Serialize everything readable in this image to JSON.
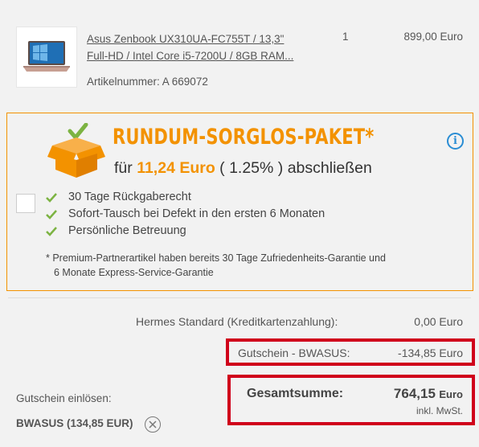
{
  "product": {
    "title_line1": "Asus Zenbook UX310UA-FC755T / 13,3\"",
    "title_line2": "Full-HD / Intel Core i5-7200U / 8GB RAM...",
    "article_number": "Artikelnummer: A 669072",
    "quantity": "1",
    "price": "899,00 Euro",
    "image_icon": "laptop-thumbnail"
  },
  "paket": {
    "title": "RUNDUM-SORGLOS-PAKET*",
    "sub_prefix": "für ",
    "sub_price": "11,24 Euro",
    "sub_percent": " ( 1.25% ) abschließen",
    "benefits": [
      "30 Tage Rückgaberecht",
      "Sofort-Tausch bei Defekt in den ersten 6 Monaten",
      "Persönliche Betreuung"
    ],
    "note_line1": "* Premium-Partnerartikel haben bereits 30 Tage Zufriedenheits-Garantie und",
    "note_line2": "6 Monate Express-Service-Garantie",
    "info_symbol": "i",
    "accent_color": "#f39200",
    "check_color": "#7cb342"
  },
  "shipping": {
    "label": "Hermes Standard (Kreditkartenzahlung):",
    "value": "0,00 Euro"
  },
  "voucher_row": {
    "label": "Gutschein - BWASUS:",
    "value": "-134,85 Euro"
  },
  "total": {
    "label": "Gesamtsumme:",
    "amount": "764,15",
    "currency": "Euro",
    "tax_note": "inkl. MwSt."
  },
  "redeem": {
    "label": "Gutschein einlösen:",
    "code": "BWASUS (134,85 EUR)"
  },
  "highlight_color": "#d0021b"
}
